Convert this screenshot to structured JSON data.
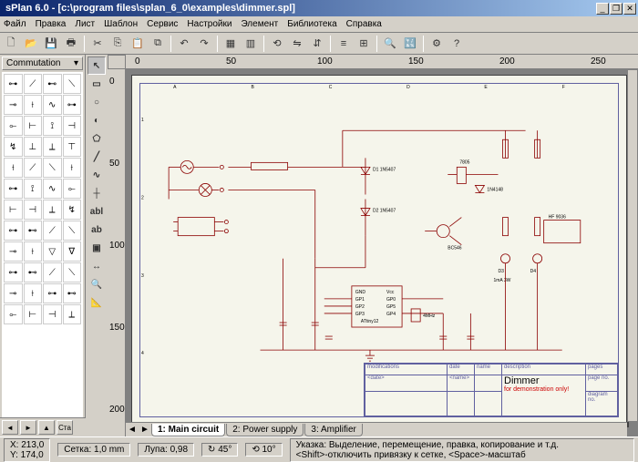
{
  "title": "sPlan 6.0 - [c:\\program files\\splan_6_0\\examples\\dimmer.spl]",
  "menu": [
    "Файл",
    "Правка",
    "Лист",
    "Шаблон",
    "Сервис",
    "Настройки",
    "Элемент",
    "Библиотека",
    "Справка"
  ],
  "library_tab": "Commutation",
  "ruler_h": [
    "0",
    "50",
    "100",
    "150",
    "200",
    "250"
  ],
  "ruler_v": [
    "0",
    "50",
    "100",
    "150",
    "200"
  ],
  "grid_cols": [
    "A",
    "B",
    "C",
    "D",
    "E",
    "F"
  ],
  "grid_rows": [
    "1",
    "2",
    "3",
    "4"
  ],
  "tabs": [
    {
      "n": "1",
      "label": "Main circuit",
      "active": true
    },
    {
      "n": "2",
      "label": "Power supply",
      "active": false
    },
    {
      "n": "3",
      "label": "Amplifier",
      "active": false
    }
  ],
  "titleblock": {
    "h_mod": "modifications",
    "h_date": "date",
    "h_name": "name",
    "h_desc": "description",
    "h_pages": "pages",
    "h_date2": "<date>",
    "h_name2": "<name>",
    "h_diag": "diagram no.",
    "h_pageno": "page no.",
    "desc": "Dimmer",
    "demo": "for demonstration only!"
  },
  "coords": {
    "x": "X: 213,0",
    "y": "Y: 174,0"
  },
  "status": {
    "grid": "Сетка: 1,0 mm",
    "zoom": "Лупа: 0,98",
    "angle": "45°",
    "rotate": "10°",
    "hint": "Указка: Выделение, перемещение, правка, копирование и т.д.\n<Shift>-отключить привязку к сетке,  <Space>-масштаб"
  },
  "tool_labels": {
    "abl": "abl",
    "ab": "ab"
  }
}
